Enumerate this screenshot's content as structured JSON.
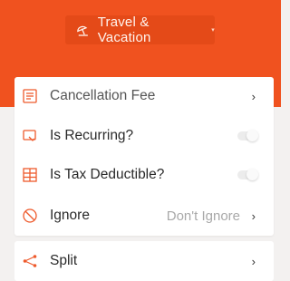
{
  "header": {
    "category_label": "Travel & Vacation",
    "category_icon": "beach-umbrella-icon",
    "caret": "▾",
    "accent_color": "#f0521f"
  },
  "rows": [
    {
      "label": "Cancellation Fee",
      "icon": "receipt-icon",
      "chevron": "›"
    },
    {
      "label": "Is Recurring?",
      "icon": "recurring-icon",
      "toggle": false
    },
    {
      "label": "Is Tax Deductible?",
      "icon": "tax-grid-icon",
      "toggle": false
    },
    {
      "label": "Ignore",
      "icon": "ignore-icon",
      "value": "Don't Ignore",
      "chevron": "›"
    }
  ],
  "split": {
    "label": "Split",
    "icon": "split-icon",
    "chevron": "›"
  }
}
